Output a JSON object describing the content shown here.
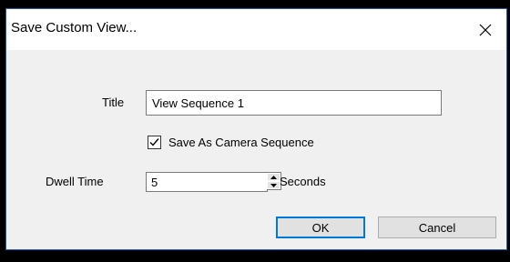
{
  "dialog": {
    "title": "Save Custom View...",
    "close_icon": "close-icon"
  },
  "form": {
    "title_label": "Title",
    "title_value": "View Sequence 1",
    "camera_sequence_label": "Save As Camera Sequence",
    "camera_sequence_checked": true,
    "dwell_label": "Dwell Time",
    "dwell_value": "5",
    "dwell_unit": "Seconds"
  },
  "buttons": {
    "ok_label": "OK",
    "cancel_label": "Cancel"
  },
  "colors": {
    "accent": "#0078d7",
    "dialog_border": "#1f5fa8"
  }
}
